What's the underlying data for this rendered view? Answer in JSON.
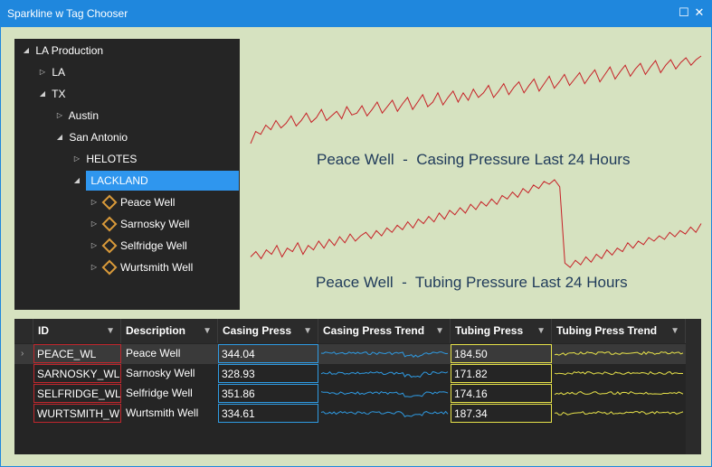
{
  "window": {
    "title": "Sparkline w Tag Chooser"
  },
  "tree": {
    "root": "LA Production",
    "la": "LA",
    "tx": "TX",
    "austin": "Austin",
    "san_antonio": "San Antonio",
    "helotes": "HELOTES",
    "lackland": "LACKLAND",
    "wells": [
      "Peace Well",
      "Sarnosky Well",
      "Selfridge Well",
      "Wurtsmith Well"
    ]
  },
  "sparklines": {
    "casing_title": "Peace Well  -  Casing Pressure Last 24 Hours",
    "tubing_title": "Peace Well  -  Tubing Pressure Last 24 Hours",
    "line_color": "#c62026",
    "casing_values": [
      0.05,
      0.18,
      0.15,
      0.25,
      0.2,
      0.3,
      0.22,
      0.27,
      0.35,
      0.24,
      0.3,
      0.38,
      0.28,
      0.33,
      0.42,
      0.3,
      0.35,
      0.4,
      0.32,
      0.45,
      0.36,
      0.38,
      0.46,
      0.35,
      0.42,
      0.5,
      0.38,
      0.45,
      0.52,
      0.4,
      0.48,
      0.55,
      0.42,
      0.5,
      0.58,
      0.45,
      0.5,
      0.6,
      0.47,
      0.55,
      0.62,
      0.5,
      0.6,
      0.52,
      0.64,
      0.55,
      0.6,
      0.68,
      0.55,
      0.62,
      0.7,
      0.58,
      0.66,
      0.72,
      0.6,
      0.68,
      0.75,
      0.62,
      0.7,
      0.78,
      0.65,
      0.72,
      0.8,
      0.68,
      0.75,
      0.82,
      0.7,
      0.78,
      0.85,
      0.72,
      0.8,
      0.88,
      0.75,
      0.83,
      0.9,
      0.78,
      0.86,
      0.92,
      0.8,
      0.88,
      0.95,
      0.82,
      0.9,
      0.96,
      0.86,
      0.93,
      0.98,
      0.9,
      0.96,
      1.0
    ],
    "tubing_values": [
      0.12,
      0.18,
      0.1,
      0.2,
      0.15,
      0.25,
      0.12,
      0.22,
      0.18,
      0.28,
      0.15,
      0.25,
      0.2,
      0.3,
      0.22,
      0.32,
      0.25,
      0.35,
      0.28,
      0.38,
      0.3,
      0.36,
      0.4,
      0.33,
      0.42,
      0.36,
      0.45,
      0.4,
      0.48,
      0.43,
      0.52,
      0.45,
      0.55,
      0.5,
      0.58,
      0.52,
      0.62,
      0.55,
      0.65,
      0.6,
      0.68,
      0.62,
      0.72,
      0.66,
      0.75,
      0.7,
      0.78,
      0.72,
      0.82,
      0.78,
      0.86,
      0.8,
      0.9,
      0.85,
      0.94,
      0.9,
      0.98,
      0.95,
      1.0,
      0.92,
      0.05,
      0.0,
      0.08,
      0.03,
      0.12,
      0.06,
      0.15,
      0.1,
      0.2,
      0.14,
      0.22,
      0.18,
      0.28,
      0.22,
      0.3,
      0.26,
      0.34,
      0.3,
      0.36,
      0.32,
      0.4,
      0.35,
      0.42,
      0.38,
      0.46,
      0.4,
      0.5
    ]
  },
  "grid": {
    "columns": [
      "ID",
      "Description",
      "Casing Press",
      "Casing Press Trend",
      "Tubing Press",
      "Tubing Press Trend"
    ],
    "rows": [
      {
        "id": "PEACE_WL",
        "description": "Peace Well",
        "casing_press": "344.04",
        "tubing_press": "184.50"
      },
      {
        "id": "SARNOSKY_WL",
        "description": "Sarnosky Well",
        "casing_press": "328.93",
        "tubing_press": "171.82"
      },
      {
        "id": "SELFRIDGE_WL",
        "description": "Selfridge Well",
        "casing_press": "351.86",
        "tubing_press": "174.16"
      },
      {
        "id": "WURTSMITH_WL",
        "description": "Wurtsmith Well",
        "casing_press": "334.61",
        "tubing_press": "187.34"
      }
    ],
    "casing_trend_color": "#2f9be3",
    "tubing_trend_color": "#e7e24a"
  },
  "icons": {
    "maximize": "maximize-icon",
    "close": "close-icon",
    "filter": "filter-icon",
    "expand": "expand-arrow-icon",
    "collapse": "collapse-arrow-icon",
    "tag": "tag-diamond-icon"
  }
}
